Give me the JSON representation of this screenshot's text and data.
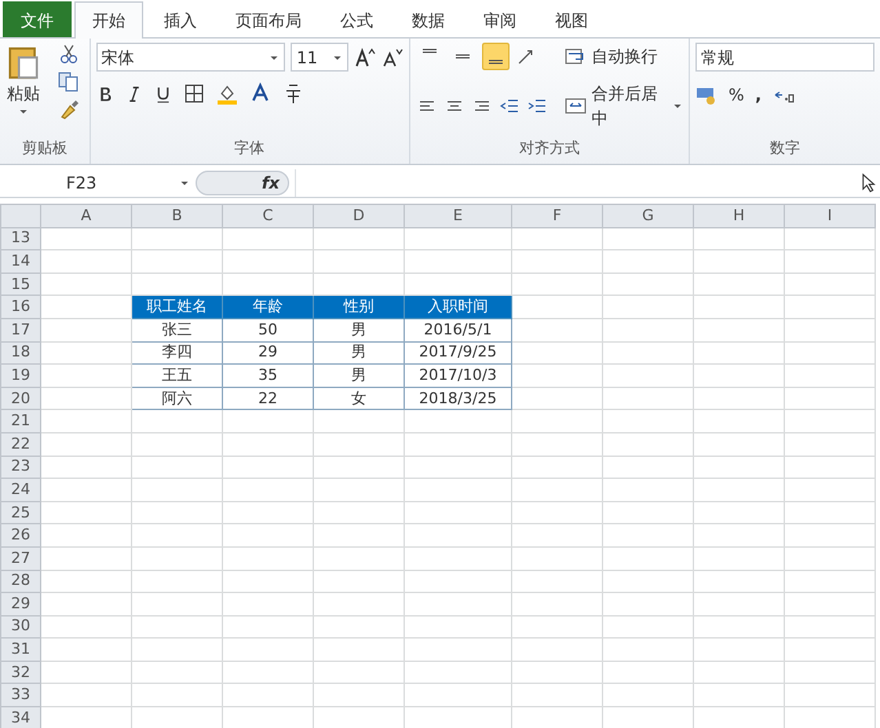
{
  "tabs": [
    {
      "label": "文件",
      "kind": "file",
      "selected": false
    },
    {
      "label": "开始",
      "kind": "tab",
      "selected": true
    },
    {
      "label": "插入",
      "kind": "tab",
      "selected": false
    },
    {
      "label": "页面布局",
      "kind": "tab",
      "selected": false
    },
    {
      "label": "公式",
      "kind": "tab",
      "selected": false
    },
    {
      "label": "数据",
      "kind": "tab",
      "selected": false
    },
    {
      "label": "审阅",
      "kind": "tab",
      "selected": false
    },
    {
      "label": "视图",
      "kind": "tab",
      "selected": false
    }
  ],
  "ribbon": {
    "clipboard": {
      "paste_label": "粘贴",
      "group_label": "剪贴板"
    },
    "font": {
      "font_name": "宋体",
      "font_size": "11",
      "group_label": "字体"
    },
    "alignment": {
      "vertical_align": [
        {
          "selected": false
        },
        {
          "selected": false
        },
        {
          "selected": true
        }
      ],
      "wrap_label": "自动换行",
      "merge_label": "合并后居中",
      "group_label": "对齐方式"
    },
    "number": {
      "format": "常规",
      "percent": "%",
      "comma": ",",
      "group_label": "数字"
    }
  },
  "formula_bar": {
    "name_box": "F23",
    "fx": "fx"
  },
  "columns": [
    "A",
    "B",
    "C",
    "D",
    "E",
    "F",
    "G",
    "H",
    "I"
  ],
  "row_numbers": [
    "13",
    "14",
    "15",
    "16",
    "17",
    "18",
    "19",
    "20",
    "21",
    "22",
    "23",
    "24",
    "25",
    "26",
    "27",
    "28",
    "29",
    "30",
    "31",
    "32",
    "33",
    "34"
  ],
  "table": {
    "header": [
      "职工姓名",
      "年龄",
      "性别",
      "入职时间"
    ],
    "rows": [
      [
        "张三",
        "50",
        "男",
        "2016/5/1"
      ],
      [
        "李四",
        "29",
        "男",
        "2017/9/25"
      ],
      [
        "王五",
        "35",
        "男",
        "2017/10/3"
      ],
      [
        "阿六",
        "22",
        "女",
        "2018/3/25"
      ]
    ]
  }
}
